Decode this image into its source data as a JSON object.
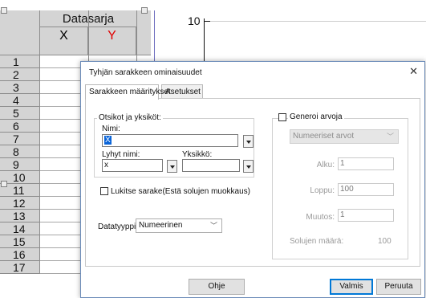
{
  "sheet": {
    "dataset_label": "Datasarja",
    "col_x": "X",
    "col_y": "Y",
    "rows": [
      "1",
      "2",
      "3",
      "4",
      "5",
      "6",
      "7",
      "8",
      "9",
      "10",
      "11",
      "12",
      "13",
      "14",
      "15",
      "16",
      "17"
    ]
  },
  "graph": {
    "top_tick": "10"
  },
  "dialog": {
    "title": "Tyhjän sarakkeen ominaisuudet",
    "tabs": [
      {
        "label": "Sarakkeen määritykset"
      },
      {
        "label": "Asetukset"
      }
    ],
    "titles_group": {
      "legend": "Otsikot ja yksiköt:",
      "name_label": "Nimi:",
      "name_value": "X",
      "short_name_label": "Lyhyt nimi:",
      "short_name_value": "x",
      "unit_label": "Yksikkö:",
      "unit_value": ""
    },
    "lock_label": "Lukitse sarake(Estä solujen muokkaus)",
    "datatype_label": "Datatyyppi:",
    "datatype_value": "Numeerinen",
    "generate": {
      "label": "Generoi arvoja",
      "type_value": "Numeeriset arvot",
      "start_label": "Alku:",
      "start_value": "1",
      "end_label": "Loppu:",
      "end_value": "100",
      "step_label": "Muutos:",
      "step_value": "1",
      "count_label": "Solujen määrä:",
      "count_value": "100"
    },
    "buttons": {
      "help": "Ohje",
      "ok": "Valmis",
      "cancel": "Peruuta"
    }
  }
}
